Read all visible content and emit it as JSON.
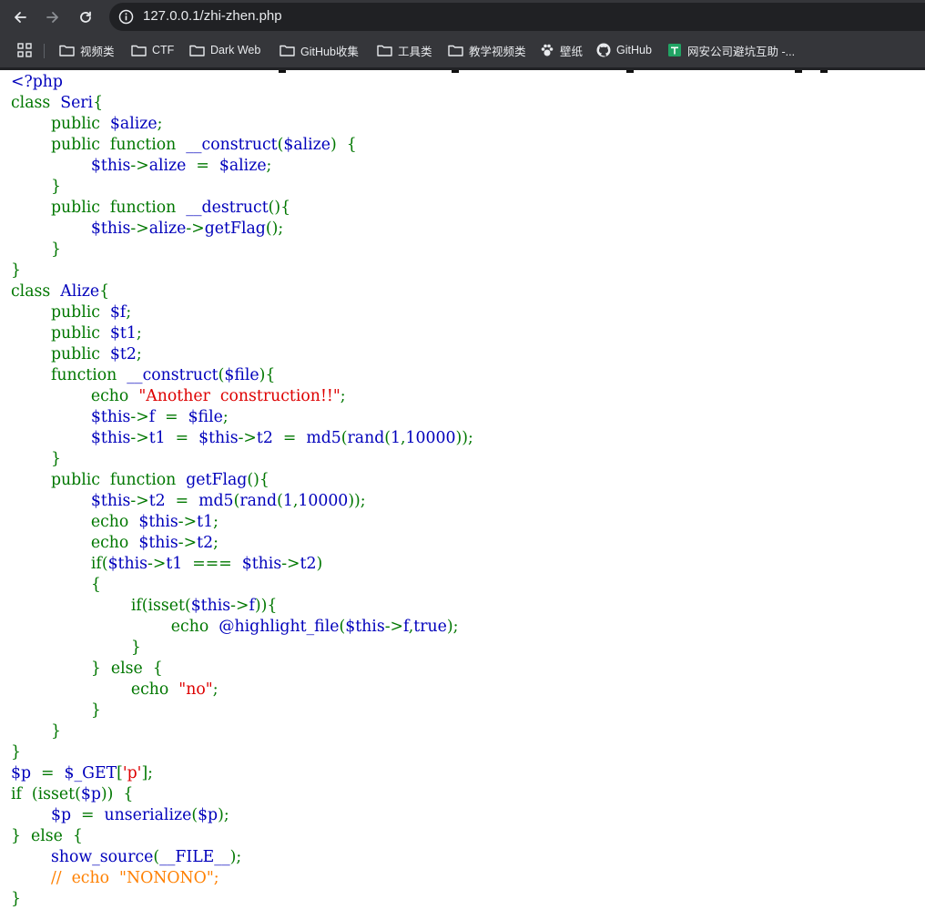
{
  "browser": {
    "url": "127.0.0.1/zhi-zhen.php",
    "bookmarks": [
      {
        "label": "视频类",
        "icon": "folder-icon"
      },
      {
        "label": "CTF",
        "icon": "folder-icon"
      },
      {
        "label": "Dark Web",
        "icon": "folder-icon"
      },
      {
        "label": "GitHub收集",
        "icon": "folder-icon"
      },
      {
        "label": "工具类",
        "icon": "folder-icon"
      },
      {
        "label": "教学视频类",
        "icon": "folder-icon"
      },
      {
        "label": "壁纸",
        "icon": "paw-icon"
      },
      {
        "label": "GitHub",
        "icon": "github-icon"
      },
      {
        "label": "网安公司避坑互助 -...",
        "icon": "sheets-icon"
      }
    ]
  },
  "colors": {
    "keyword": "#007700",
    "default": "#0000bb",
    "string": "#dd0000",
    "comment": "#ff8000"
  },
  "source_lines": [
    [
      [
        "d",
        "<?php"
      ]
    ],
    [
      [
        "k",
        "class  "
      ],
      [
        "d",
        "Seri"
      ],
      [
        "k",
        "{"
      ]
    ],
    [
      [
        "k",
        "        public  "
      ],
      [
        "d",
        "$alize"
      ],
      [
        "k",
        ";"
      ]
    ],
    [
      [
        "k",
        "        public  function  "
      ],
      [
        "d",
        "__construct"
      ],
      [
        "k",
        "("
      ],
      [
        "d",
        "$alize"
      ],
      [
        "k",
        ")  {"
      ]
    ],
    [
      [
        "k",
        "                "
      ],
      [
        "d",
        "$this"
      ],
      [
        "k",
        "->"
      ],
      [
        "d",
        "alize  "
      ],
      [
        "k",
        "=  "
      ],
      [
        "d",
        "$alize"
      ],
      [
        "k",
        ";"
      ]
    ],
    [
      [
        "k",
        "        }"
      ]
    ],
    [
      [
        "k",
        "        public  function  "
      ],
      [
        "d",
        "__destruct"
      ],
      [
        "k",
        "(){"
      ]
    ],
    [
      [
        "k",
        "                "
      ],
      [
        "d",
        "$this"
      ],
      [
        "k",
        "->"
      ],
      [
        "d",
        "alize"
      ],
      [
        "k",
        "->"
      ],
      [
        "d",
        "getFlag"
      ],
      [
        "k",
        "();"
      ]
    ],
    [
      [
        "k",
        "        }"
      ]
    ],
    [
      [
        "k",
        "}"
      ]
    ],
    [
      [
        "k",
        "class  "
      ],
      [
        "d",
        "Alize"
      ],
      [
        "k",
        "{"
      ]
    ],
    [
      [
        "k",
        "        public  "
      ],
      [
        "d",
        "$f"
      ],
      [
        "k",
        ";"
      ]
    ],
    [
      [
        "k",
        "        public  "
      ],
      [
        "d",
        "$t1"
      ],
      [
        "k",
        ";"
      ]
    ],
    [
      [
        "k",
        "        public  "
      ],
      [
        "d",
        "$t2"
      ],
      [
        "k",
        ";"
      ]
    ],
    [
      [
        "k",
        "        function  "
      ],
      [
        "d",
        "__construct"
      ],
      [
        "k",
        "("
      ],
      [
        "d",
        "$file"
      ],
      [
        "k",
        "){"
      ]
    ],
    [
      [
        "k",
        "                echo  "
      ],
      [
        "s",
        "\"Another  construction!!\""
      ],
      [
        "k",
        ";"
      ]
    ],
    [
      [
        "k",
        "                "
      ],
      [
        "d",
        "$this"
      ],
      [
        "k",
        "->"
      ],
      [
        "d",
        "f  "
      ],
      [
        "k",
        "=  "
      ],
      [
        "d",
        "$file"
      ],
      [
        "k",
        ";"
      ]
    ],
    [
      [
        "k",
        "                "
      ],
      [
        "d",
        "$this"
      ],
      [
        "k",
        "->"
      ],
      [
        "d",
        "t1  "
      ],
      [
        "k",
        "=  "
      ],
      [
        "d",
        "$this"
      ],
      [
        "k",
        "->"
      ],
      [
        "d",
        "t2  "
      ],
      [
        "k",
        "=  "
      ],
      [
        "d",
        "md5"
      ],
      [
        "k",
        "("
      ],
      [
        "d",
        "rand"
      ],
      [
        "k",
        "("
      ],
      [
        "d",
        "1"
      ],
      [
        "k",
        ","
      ],
      [
        "d",
        "10000"
      ],
      [
        "k",
        "));"
      ]
    ],
    [
      [
        "k",
        "        }"
      ]
    ],
    [
      [
        "k",
        "        public  function  "
      ],
      [
        "d",
        "getFlag"
      ],
      [
        "k",
        "(){"
      ]
    ],
    [
      [
        "k",
        "                "
      ],
      [
        "d",
        "$this"
      ],
      [
        "k",
        "->"
      ],
      [
        "d",
        "t2  "
      ],
      [
        "k",
        "=  "
      ],
      [
        "d",
        "md5"
      ],
      [
        "k",
        "("
      ],
      [
        "d",
        "rand"
      ],
      [
        "k",
        "("
      ],
      [
        "d",
        "1"
      ],
      [
        "k",
        ","
      ],
      [
        "d",
        "10000"
      ],
      [
        "k",
        "));"
      ]
    ],
    [
      [
        "k",
        "                echo  "
      ],
      [
        "d",
        "$this"
      ],
      [
        "k",
        "->"
      ],
      [
        "d",
        "t1"
      ],
      [
        "k",
        ";"
      ]
    ],
    [
      [
        "k",
        "                echo  "
      ],
      [
        "d",
        "$this"
      ],
      [
        "k",
        "->"
      ],
      [
        "d",
        "t2"
      ],
      [
        "k",
        ";"
      ]
    ],
    [
      [
        "k",
        "                if("
      ],
      [
        "d",
        "$this"
      ],
      [
        "k",
        "->"
      ],
      [
        "d",
        "t1  "
      ],
      [
        "k",
        "===  "
      ],
      [
        "d",
        "$this"
      ],
      [
        "k",
        "->"
      ],
      [
        "d",
        "t2"
      ],
      [
        "k",
        ")"
      ]
    ],
    [
      [
        "k",
        "                {"
      ]
    ],
    [
      [
        "k",
        "                        if(isset("
      ],
      [
        "d",
        "$this"
      ],
      [
        "k",
        "->"
      ],
      [
        "d",
        "f"
      ],
      [
        "k",
        ")){"
      ]
    ],
    [
      [
        "k",
        "                                echo  "
      ],
      [
        "d",
        "@highlight_file"
      ],
      [
        "k",
        "("
      ],
      [
        "d",
        "$this"
      ],
      [
        "k",
        "->"
      ],
      [
        "d",
        "f"
      ],
      [
        "k",
        ","
      ],
      [
        "d",
        "true"
      ],
      [
        "k",
        ");"
      ]
    ],
    [
      [
        "k",
        "                        }"
      ]
    ],
    [
      [
        "k",
        "                }  else  {"
      ]
    ],
    [
      [
        "k",
        "                        echo  "
      ],
      [
        "s",
        "\"no\""
      ],
      [
        "k",
        ";"
      ]
    ],
    [
      [
        "k",
        "                }"
      ]
    ],
    [
      [
        "k",
        "        }"
      ]
    ],
    [
      [
        "k",
        "}"
      ]
    ],
    [
      [
        "d",
        "$p  "
      ],
      [
        "k",
        "=  "
      ],
      [
        "d",
        "$_GET"
      ],
      [
        "k",
        "["
      ],
      [
        "s",
        "'p'"
      ],
      [
        "k",
        "];"
      ]
    ],
    [
      [
        "k",
        "if  (isset("
      ],
      [
        "d",
        "$p"
      ],
      [
        "k",
        "))  {"
      ]
    ],
    [
      [
        "k",
        "        "
      ],
      [
        "d",
        "$p  "
      ],
      [
        "k",
        "=  "
      ],
      [
        "d",
        "unserialize"
      ],
      [
        "k",
        "("
      ],
      [
        "d",
        "$p"
      ],
      [
        "k",
        ");"
      ]
    ],
    [
      [
        "k",
        "}  else  {"
      ]
    ],
    [
      [
        "k",
        "        "
      ],
      [
        "d",
        "show_source"
      ],
      [
        "k",
        "("
      ],
      [
        "d",
        "__FILE__"
      ],
      [
        "k",
        ");"
      ]
    ],
    [
      [
        "c",
        "        //  echo  \"NONONO\";"
      ]
    ],
    [
      [
        "k",
        "}"
      ]
    ]
  ]
}
